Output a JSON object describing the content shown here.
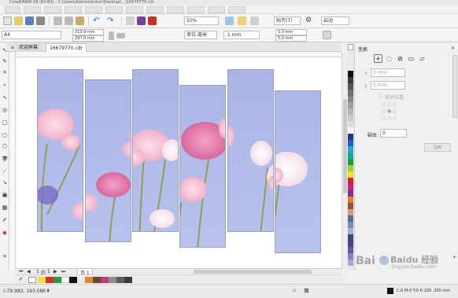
{
  "window": {
    "title": "CorelDRAW X8 (64-Bit) - C:\\Users\\Administrator\\Desktop\\...\\16679770.cdr"
  },
  "menu": {
    "item_count": 11
  },
  "toolbar": {
    "zoom_value": "50%",
    "snap_label": "贴齐(T)",
    "launch_label": "启动"
  },
  "property_bar": {
    "page_size": "A4",
    "width": "210.0 mm",
    "height": "297.0 mm",
    "units": "单位:毫米",
    "nudge": ".1 mm",
    "dup_x": "5.0 mm",
    "dup_y": "5.0 mm"
  },
  "tabs": {
    "welcome": "欢迎屏幕",
    "document": "16679770.cdr"
  },
  "canvas": {
    "sky_color": "#a8b4e6",
    "flower_pink": "#f0a7c4",
    "flower_magenta": "#d25c96",
    "stem_color": "#8ea14c",
    "purple_flower": "#7a6cc4"
  },
  "page_nav": {
    "current": "1",
    "of_label": "的",
    "total": "1",
    "page_tab": "页 1"
  },
  "docker": {
    "title": "变换",
    "x_value": "0 mm",
    "y_value": "0 mm",
    "relative_label": "相对位置",
    "copies_label": "副本:",
    "copies_value": "0",
    "apply_label": "应用"
  },
  "status": {
    "coords": "(-79.983, 193.086 )",
    "fill_info": "C:0 M:0 Y:0 K:100  .200 mm"
  },
  "watermark": {
    "text": "Baidu 经验",
    "sub": "jingyan.baidu.com"
  }
}
